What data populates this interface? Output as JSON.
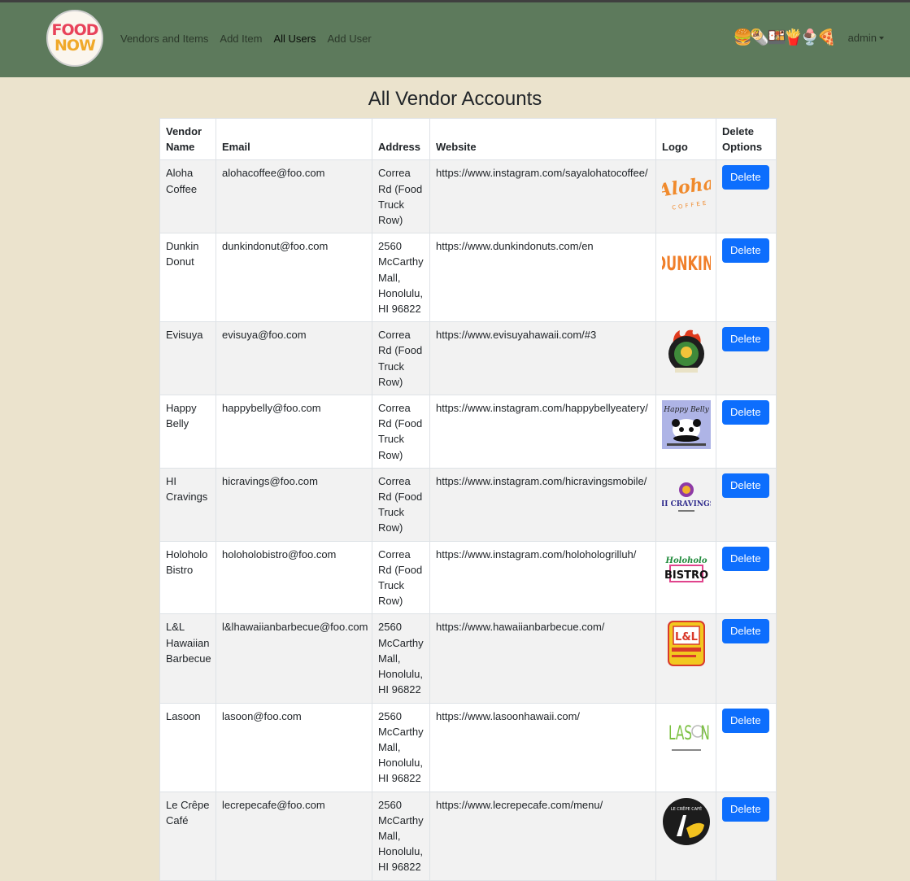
{
  "nav": {
    "brand": {
      "line1": "FOOD",
      "line2": "NOW"
    },
    "links": [
      {
        "label": "Vendors and Items",
        "active": false
      },
      {
        "label": "Add Item",
        "active": false
      },
      {
        "label": "All Users",
        "active": true
      },
      {
        "label": "Add User",
        "active": false
      }
    ],
    "emojis": "🍔🌯🍱🍟🍨🍕",
    "user": "admin"
  },
  "page": {
    "title": "All Vendor Accounts"
  },
  "table": {
    "headers": [
      "Vendor Name",
      "Email",
      "Address",
      "Website",
      "Logo",
      "Delete Options"
    ],
    "delete_label": "Delete",
    "rows": [
      {
        "name": "Aloha Coffee",
        "email": "alohacoffee@foo.com",
        "address": "Correa Rd (Food Truck Row)",
        "website": "https://www.instagram.com/sayalohatocoffee/",
        "logo": "aloha-coffee"
      },
      {
        "name": "Dunkin Donut",
        "email": "dunkindonut@foo.com",
        "address": "2560 McCarthy Mall, Honolulu, HI 96822",
        "website": "https://www.dunkindonuts.com/en",
        "logo": "dunkin"
      },
      {
        "name": "Evisuya",
        "email": "evisuya@foo.com",
        "address": "Correa Rd (Food Truck Row)",
        "website": "https://www.evisuyahawaii.com/#3",
        "logo": "evisuya"
      },
      {
        "name": "Happy Belly",
        "email": "happybelly@foo.com",
        "address": "Correa Rd (Food Truck Row)",
        "website": "https://www.instagram.com/happybellyeatery/",
        "logo": "happy-belly"
      },
      {
        "name": "HI Cravings",
        "email": "hicravings@foo.com",
        "address": "Correa Rd (Food Truck Row)",
        "website": "https://www.instagram.com/hicravingsmobile/",
        "logo": "hi-cravings"
      },
      {
        "name": "Holoholo Bistro",
        "email": "holoholobistro@foo.com",
        "address": "Correa Rd (Food Truck Row)",
        "website": "https://www.instagram.com/holohologrilluh/",
        "logo": "holoholo-bistro"
      },
      {
        "name": "L&L Hawaiian Barbecue",
        "email": "l&lhawaiianbarbecue@foo.com",
        "address": "2560 McCarthy Mall, Honolulu, HI 96822",
        "website": "https://www.hawaiianbarbecue.com/",
        "logo": "ll-bbq"
      },
      {
        "name": "Lasoon",
        "email": "lasoon@foo.com",
        "address": "2560 McCarthy Mall, Honolulu, HI 96822",
        "website": "https://www.lasoonhawaii.com/",
        "logo": "lasoon"
      },
      {
        "name": "Le Crêpe Café",
        "email": "lecrepecafe@foo.com",
        "address": "2560 McCarthy Mall, Honolulu, HI 96822",
        "website": "https://www.lecrepecafe.com/menu/",
        "logo": "le-crepe"
      }
    ]
  },
  "logos": {
    "aloha-coffee": {
      "text": "Aloha",
      "sub": "COFFEE",
      "color": "#f08a2c"
    },
    "dunkin": {
      "text": "DUNKIN'",
      "color": "#f07f2a"
    },
    "evisuya": {
      "color": "#1e1e1e"
    },
    "happy-belly": {
      "text": "Happy Belly",
      "color": "#aeb4e6"
    },
    "hi-cravings": {
      "text": "HI CRAVINGS",
      "color": "#2e2a8c"
    },
    "holoholo-bistro": {
      "text": "BISTRO",
      "sub": "Holoholo",
      "color": "#1e8a3a"
    },
    "ll-bbq": {
      "text": "L&L",
      "color": "#f2c81f"
    },
    "lasoon": {
      "text": "LAS",
      "sub": "N",
      "color": "#7cc142"
    },
    "le-crepe": {
      "text": "LE CRÊPE CAFÉ",
      "color": "#1c1c1c"
    }
  }
}
